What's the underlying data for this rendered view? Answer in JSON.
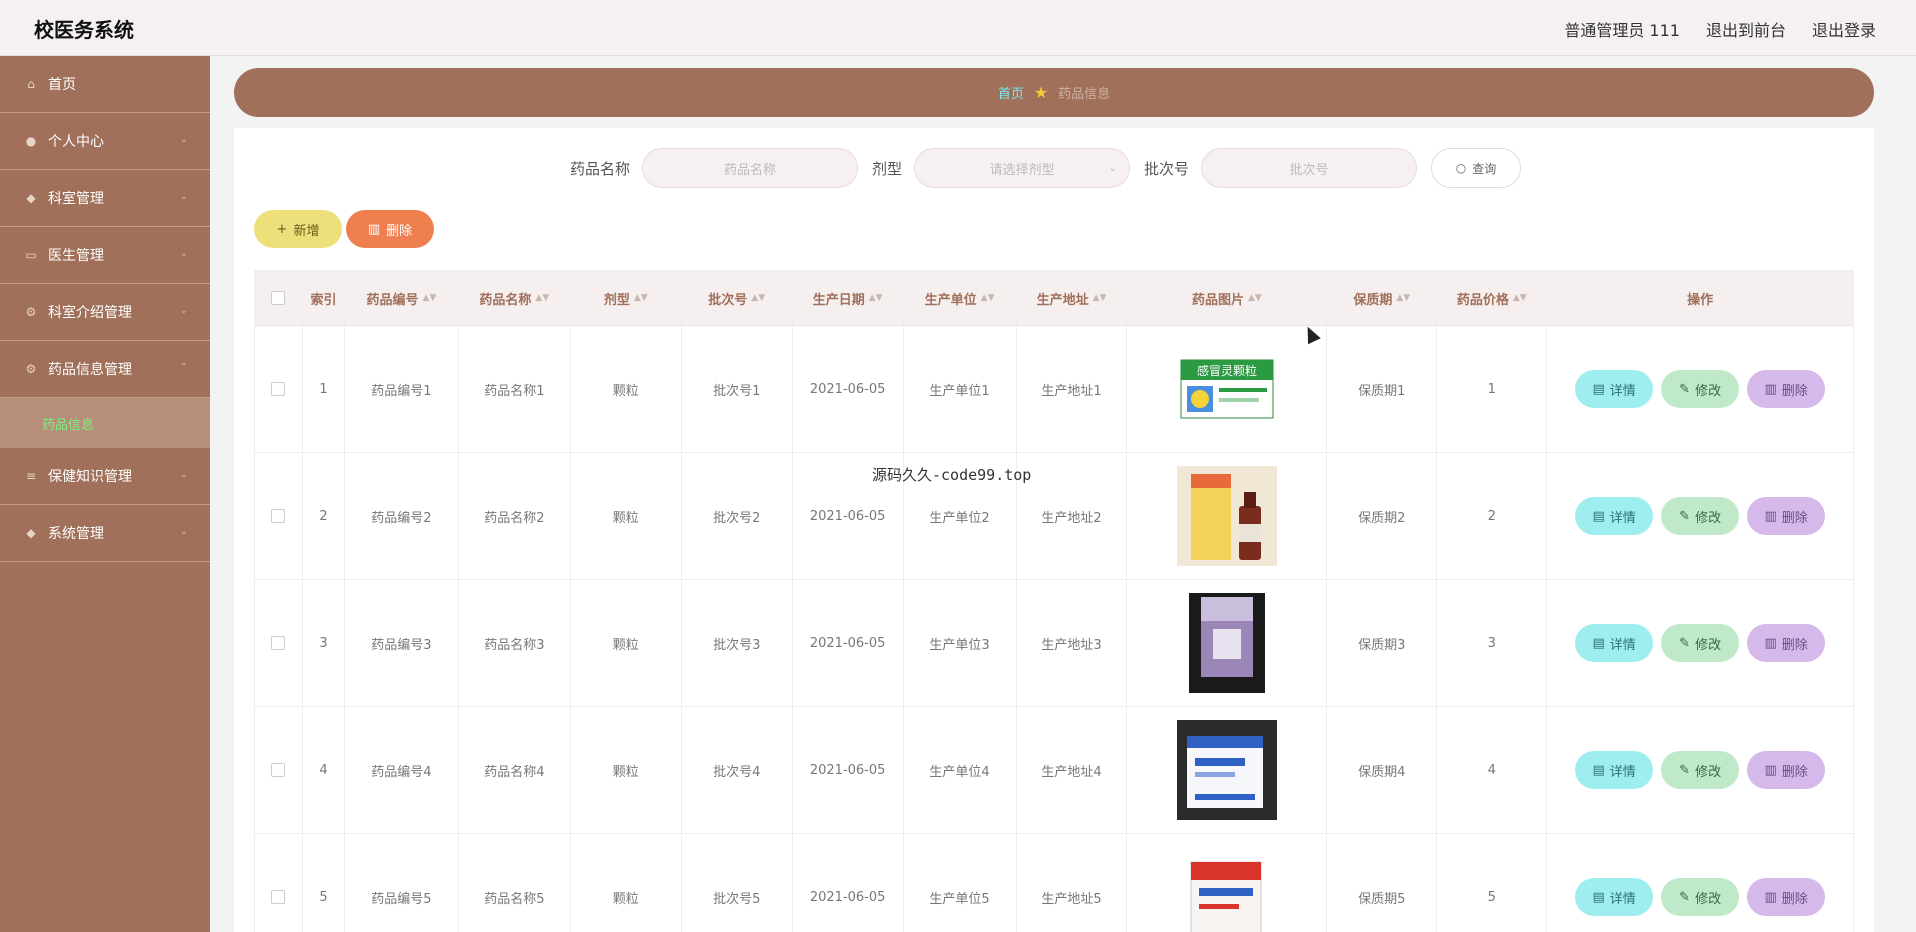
{
  "app": {
    "title": "校医务系统"
  },
  "topbar": {
    "user": "普通管理员 111",
    "front": "退出到前台",
    "logout": "退出登录"
  },
  "sidebar": {
    "items": [
      {
        "label": "首页",
        "icon": "home-icon"
      },
      {
        "label": "个人中心",
        "icon": "user-icon"
      },
      {
        "label": "科室管理",
        "icon": "pin-icon"
      },
      {
        "label": "医生管理",
        "icon": "briefcase-icon"
      },
      {
        "label": "科室介绍管理",
        "icon": "gear-icon"
      },
      {
        "label": "药品信息管理",
        "icon": "gear-icon"
      },
      {
        "label": "保健知识管理",
        "icon": "list-icon"
      },
      {
        "label": "系统管理",
        "icon": "pin-icon"
      }
    ],
    "sub_active": "药品信息"
  },
  "breadcrumb": {
    "home": "首页",
    "current": "药品信息"
  },
  "search": {
    "name_label": "药品名称",
    "name_placeholder": "药品名称",
    "type_label": "剂型",
    "type_placeholder": "请选择剂型",
    "batch_label": "批次号",
    "batch_placeholder": "批次号",
    "query": "查询"
  },
  "toolbar": {
    "add": "新增",
    "delete": "删除"
  },
  "table": {
    "headers": [
      "索引",
      "药品编号",
      "药品名称",
      "剂型",
      "批次号",
      "生产日期",
      "生产单位",
      "生产地址",
      "药品图片",
      "保质期",
      "药品价格",
      "操作"
    ],
    "rows": [
      {
        "idx": "1",
        "code": "药品编号1",
        "name": "药品名称1",
        "form": "颗粒",
        "batch": "批次号1",
        "date": "2021-06-05",
        "unit": "生产单位1",
        "addr": "生产地址1",
        "shelf": "保质期1",
        "price": "1"
      },
      {
        "idx": "2",
        "code": "药品编号2",
        "name": "药品名称2",
        "form": "颗粒",
        "batch": "批次号2",
        "date": "2021-06-05",
        "unit": "生产单位2",
        "addr": "生产地址2",
        "shelf": "保质期2",
        "price": "2"
      },
      {
        "idx": "3",
        "code": "药品编号3",
        "name": "药品名称3",
        "form": "颗粒",
        "batch": "批次号3",
        "date": "2021-06-05",
        "unit": "生产单位3",
        "addr": "生产地址3",
        "shelf": "保质期3",
        "price": "3"
      },
      {
        "idx": "4",
        "code": "药品编号4",
        "name": "药品名称4",
        "form": "颗粒",
        "batch": "批次号4",
        "date": "2021-06-05",
        "unit": "生产单位4",
        "addr": "生产地址4",
        "shelf": "保质期4",
        "price": "4"
      },
      {
        "idx": "5",
        "code": "药品编号5",
        "name": "药品名称5",
        "form": "颗粒",
        "batch": "批次号5",
        "date": "2021-06-05",
        "unit": "生产单位5",
        "addr": "生产地址5",
        "shelf": "保质期5",
        "price": "5"
      }
    ],
    "actions": {
      "detail": "详情",
      "edit": "修改",
      "delete": "删除"
    },
    "row1_image_text": "感冒灵颗粒"
  },
  "overlay": {
    "watermark": "源码久久-code99.top"
  },
  "colors": {
    "brand": "#a0705a",
    "add": "#ede07a",
    "delete": "#ef7f4f",
    "detail": "#9eeef0",
    "edit": "#bfe9c9",
    "row_delete": "#d5b9ea"
  }
}
